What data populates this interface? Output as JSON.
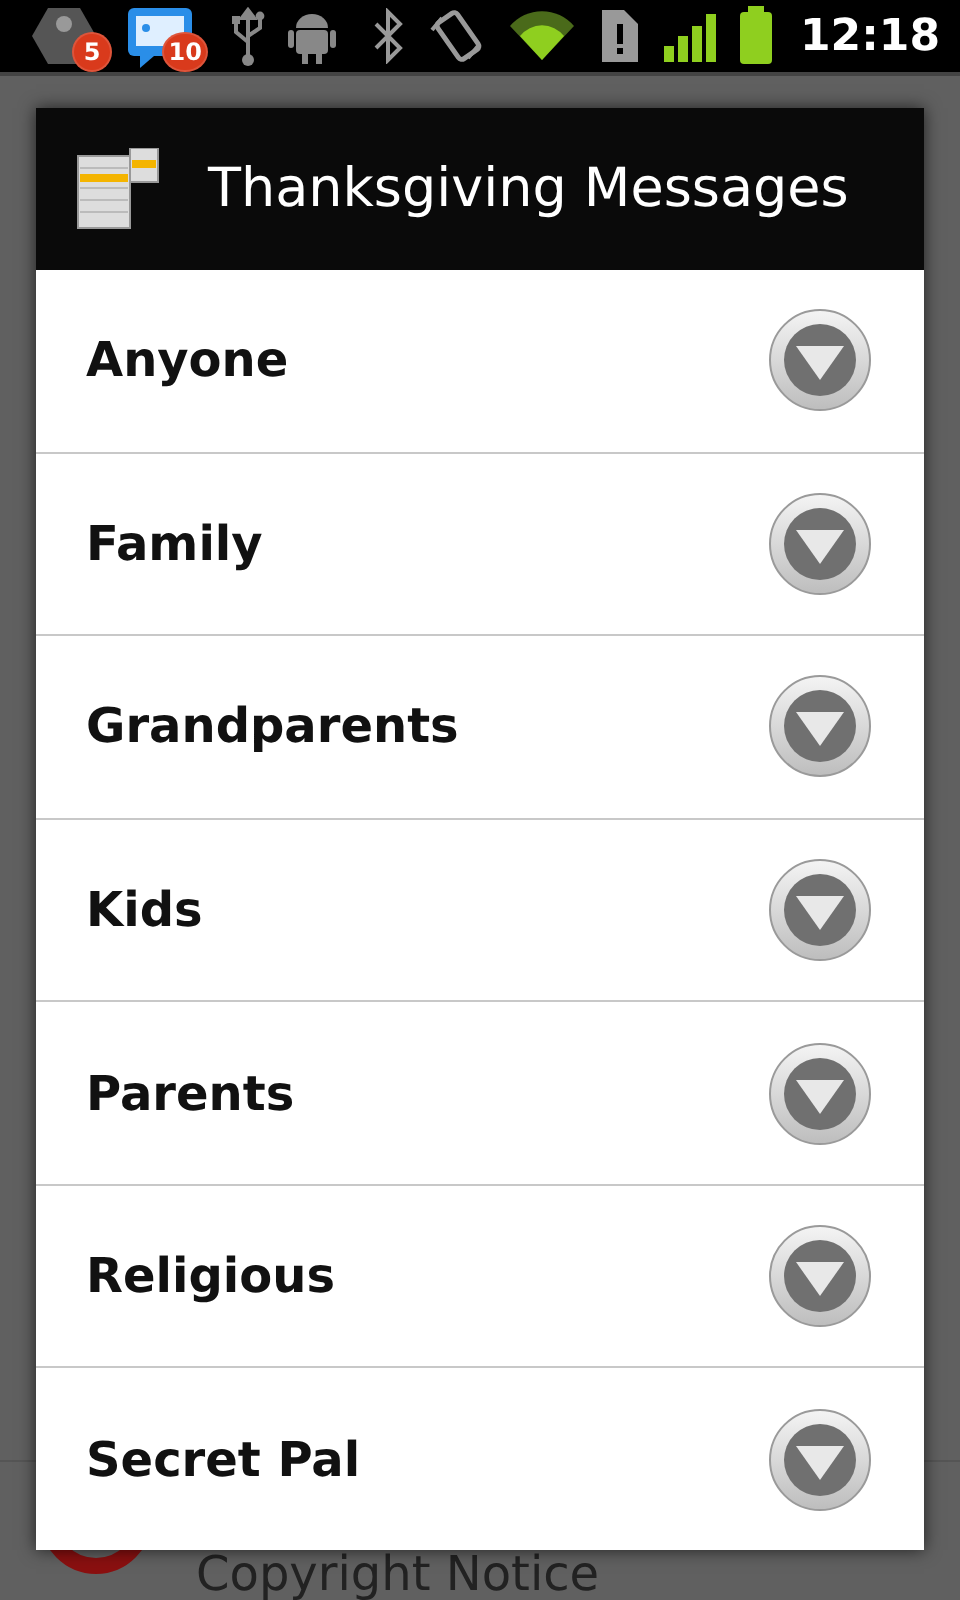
{
  "status_bar": {
    "notifications": [
      {
        "kind": "app",
        "badge": "5"
      },
      {
        "kind": "messages",
        "badge": "10"
      }
    ],
    "time": "12:18"
  },
  "background_list": {
    "items": [
      {
        "label": "Copyright Notice"
      }
    ]
  },
  "dialog": {
    "title": "Thanksgiving Messages",
    "items": [
      {
        "label": "Anyone"
      },
      {
        "label": "Family"
      },
      {
        "label": "Grandparents"
      },
      {
        "label": "Kids"
      },
      {
        "label": "Parents"
      },
      {
        "label": "Religious"
      },
      {
        "label": "Secret Pal"
      }
    ]
  }
}
